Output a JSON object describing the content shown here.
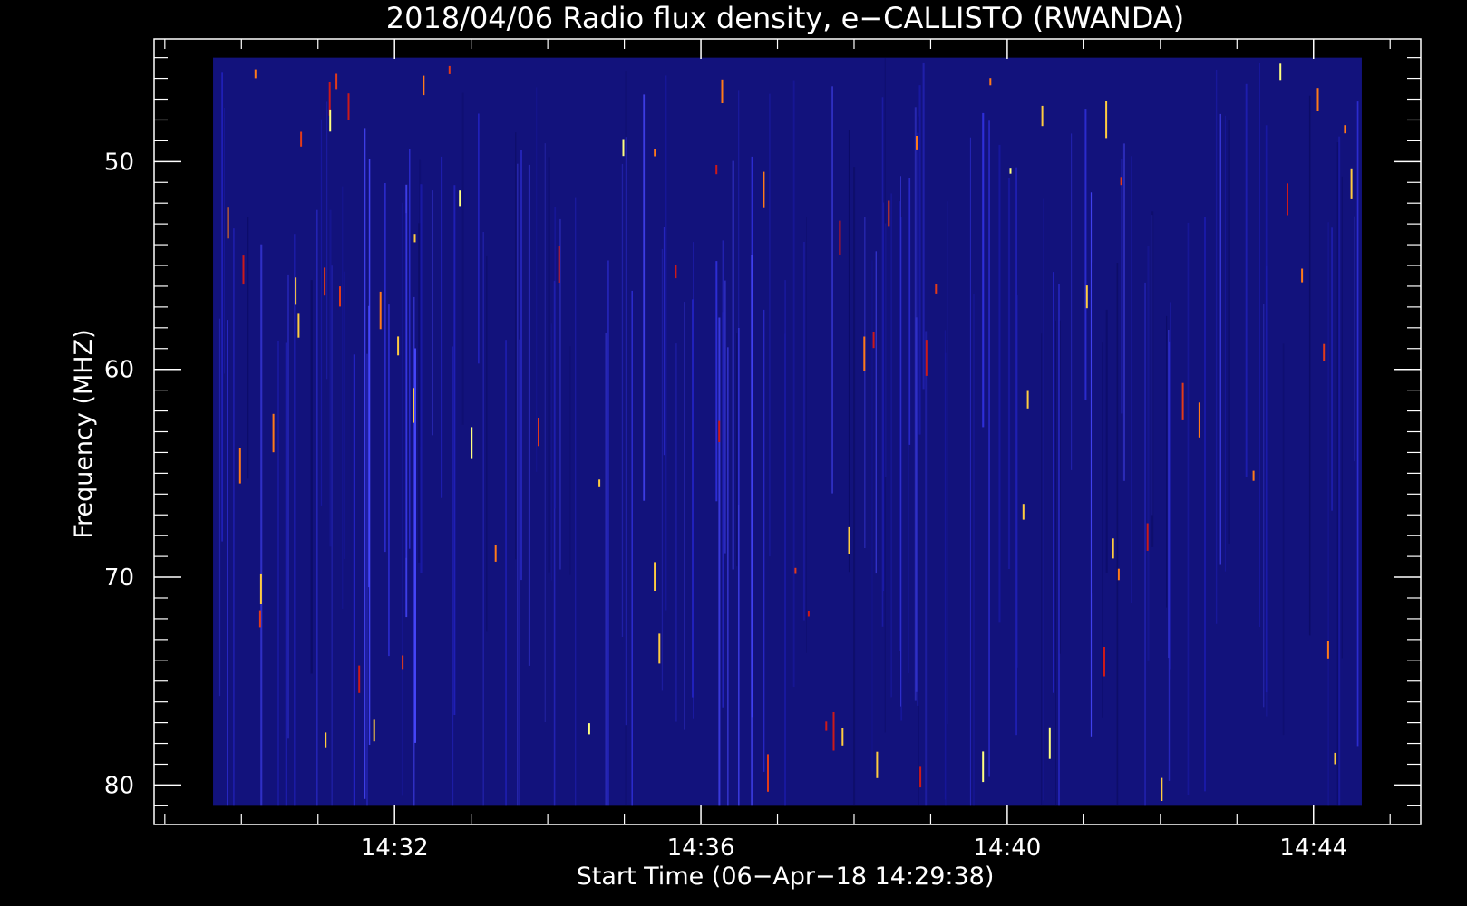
{
  "chart_data": {
    "type": "heatmap",
    "title": "2018/04/06  Radio flux density, e−CALLISTO (RWANDA)",
    "xlabel": "Start Time (06−Apr−18 14:29:38)",
    "ylabel": "Frequency (MHZ)",
    "x_ticks": [
      "14:32",
      "14:36",
      "14:40",
      "14:44"
    ],
    "y_ticks": [
      "50",
      "60",
      "70",
      "80"
    ],
    "x_tick_values_min": [
      2.37,
      6.37,
      10.37,
      14.37
    ],
    "y_tick_values": [
      50,
      60,
      70,
      80
    ],
    "y_axis_inverted": true,
    "data_x_range_min": [
      0.0,
      15.0
    ],
    "data_y_range_mhz": [
      45.0,
      81.0
    ],
    "xlim_min": [
      -0.77,
      15.77
    ],
    "ylim_mhz": [
      44.1,
      81.9
    ],
    "colormap": [
      "#000000",
      "#10107a",
      "#2222dd",
      "#5a5aff",
      "#cc1a1a",
      "#ff7a1a",
      "#ffff80"
    ],
    "background_color": "#12127c",
    "grid": false,
    "legend": "none"
  }
}
